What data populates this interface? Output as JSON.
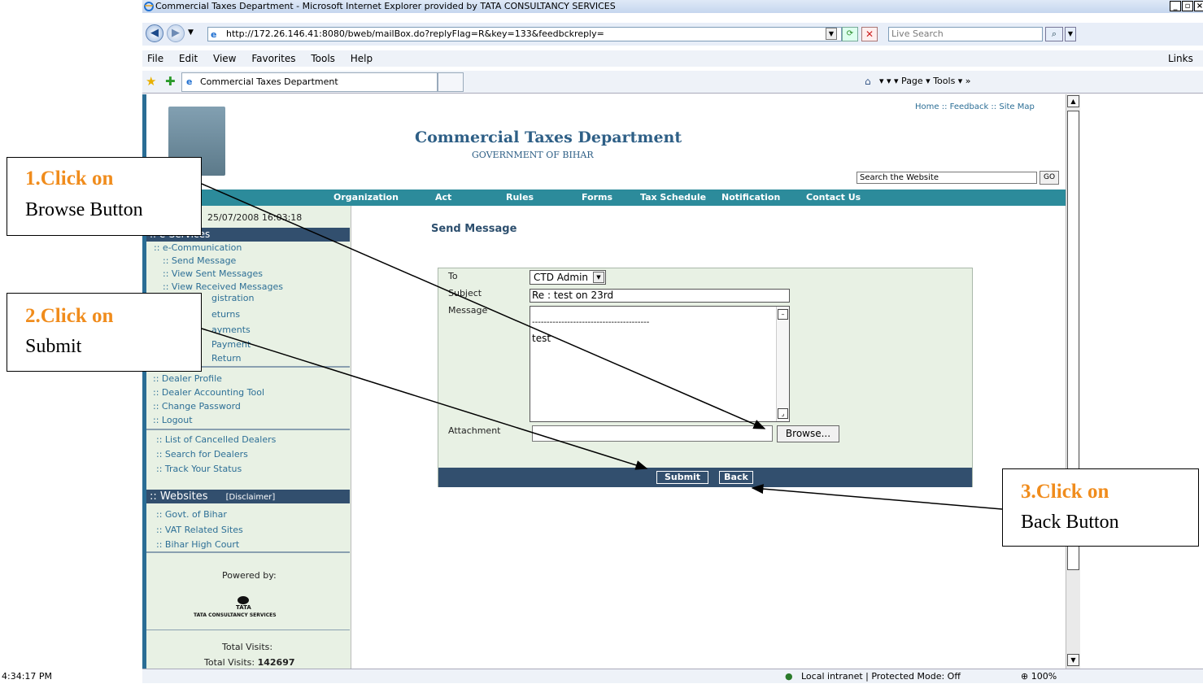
{
  "browser": {
    "window_title": "Commercial Taxes Department - Microsoft Internet Explorer provided by TATA CONSULTANCY SERVICES",
    "url": "http://172.26.146.41:8080/bweb/mailBox.do?replyFlag=R&key=133&feedbckreply=",
    "search_placeholder": "Live Search",
    "menu": [
      "File",
      "Edit",
      "View",
      "Favorites",
      "Tools",
      "Help"
    ],
    "links_label": "Links »",
    "tab_title": "Commercial Taxes Department",
    "toolbar_right": "▾ ▾ ▾ Page ▾ Tools ▾ »",
    "status_time": "4:34:17 PM",
    "status_zone": "Local intranet | Protected Mode: Off",
    "zoom": "100%"
  },
  "site": {
    "top_links": "Home :: Feedback :: Site Map",
    "title": "Commercial Taxes Department",
    "subtitle": "GOVERNMENT OF BIHAR",
    "search_placeholder": "Search the Website",
    "go_label": "GO",
    "nav": [
      "Organization",
      "Act",
      "Rules",
      "Forms",
      "Tax Schedule",
      "Notification",
      "Contact Us"
    ]
  },
  "sidebar": {
    "datetime": "25/07/2008 16:03:18",
    "eservices_header": ":: e-Services",
    "ecomm": ":: e-Communication",
    "ecomm_items": [
      ":: Send Message",
      ":: View Sent Messages",
      ":: View Received Messages"
    ],
    "partial_items": [
      "gistration",
      "eturns",
      "ayments",
      "Payment",
      "Return"
    ],
    "account_items": [
      ":: Dealer Profile",
      ":: Dealer Accounting Tool",
      ":: Change Password",
      ":: Logout"
    ],
    "dealer_items": [
      ":: List of Cancelled Dealers",
      ":: Search for Dealers",
      ":: Track Your Status"
    ],
    "websites_header": ":: Websites",
    "disclaimer": "[Disclaimer]",
    "website_items": [
      ":: Govt. of Bihar",
      ":: VAT Related Sites",
      ":: Bihar High Court"
    ],
    "powered_by": "Powered by:",
    "tcs_small": "TATA",
    "tcs_name": "TATA CONSULTANCY SERVICES",
    "total_visits_label": "Total Visits:",
    "total_visits_line": "Total Visits:",
    "total_visits_value": "142697"
  },
  "form": {
    "heading": "Send Message",
    "to_label": "To",
    "to_value": "CTD Admin",
    "subject_label": "Subject",
    "subject_value": "Re : test on 23rd",
    "message_label": "Message",
    "message_separator": "----------------------------------------",
    "message_body": "test",
    "attachment_label": "Attachment",
    "browse_label": "Browse...",
    "submit_label": "Submit",
    "back_label": "Back"
  },
  "annotations": {
    "step1_title": "1.Click on",
    "step1_text": "Browse Button",
    "step2_title": "2.Click on",
    "step2_text": "Submit",
    "step3_title": "3.Click on",
    "step3_text": "Back Button"
  }
}
